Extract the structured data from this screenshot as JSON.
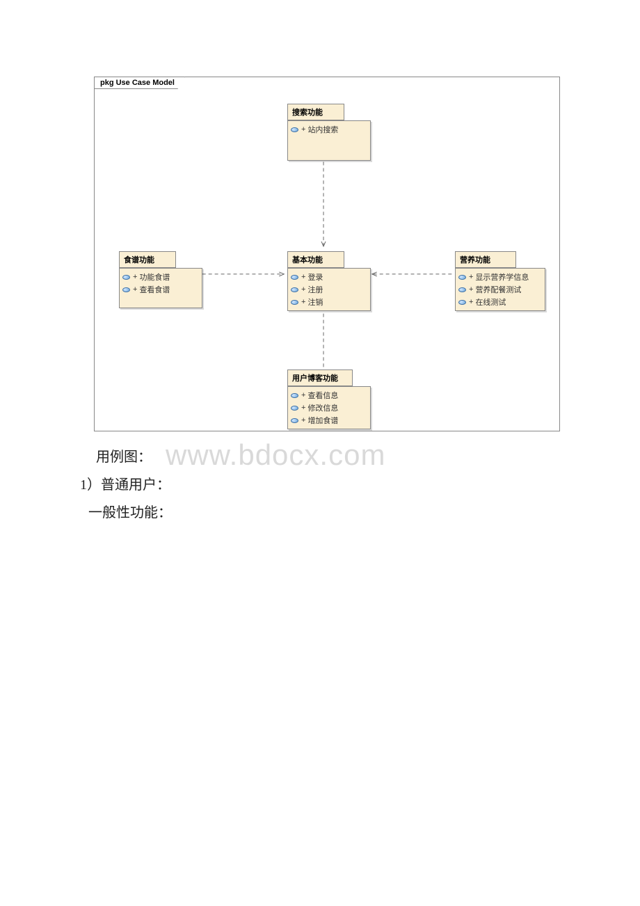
{
  "diagram": {
    "frame_label": "pkg Use Case Model",
    "packages": {
      "search": {
        "title": "搜索功能",
        "items": [
          "站内搜索"
        ]
      },
      "recipe": {
        "title": "食谱功能",
        "items": [
          "功能食谱",
          "查看食谱"
        ]
      },
      "basic": {
        "title": "基本功能",
        "items": [
          "登录",
          "注册",
          "注销"
        ]
      },
      "nutrition": {
        "title": "营养功能",
        "items": [
          "显示营养学信息",
          "营养配餐测试",
          "在线测试"
        ]
      },
      "blog": {
        "title": "用户博客功能",
        "items": [
          "查看信息",
          "修改信息",
          "增加食谱"
        ]
      }
    }
  },
  "text": {
    "line1": "用例图：",
    "line2": "1）普通用户：",
    "line3": "一般性功能："
  },
  "watermark": "www.bdocx.com"
}
